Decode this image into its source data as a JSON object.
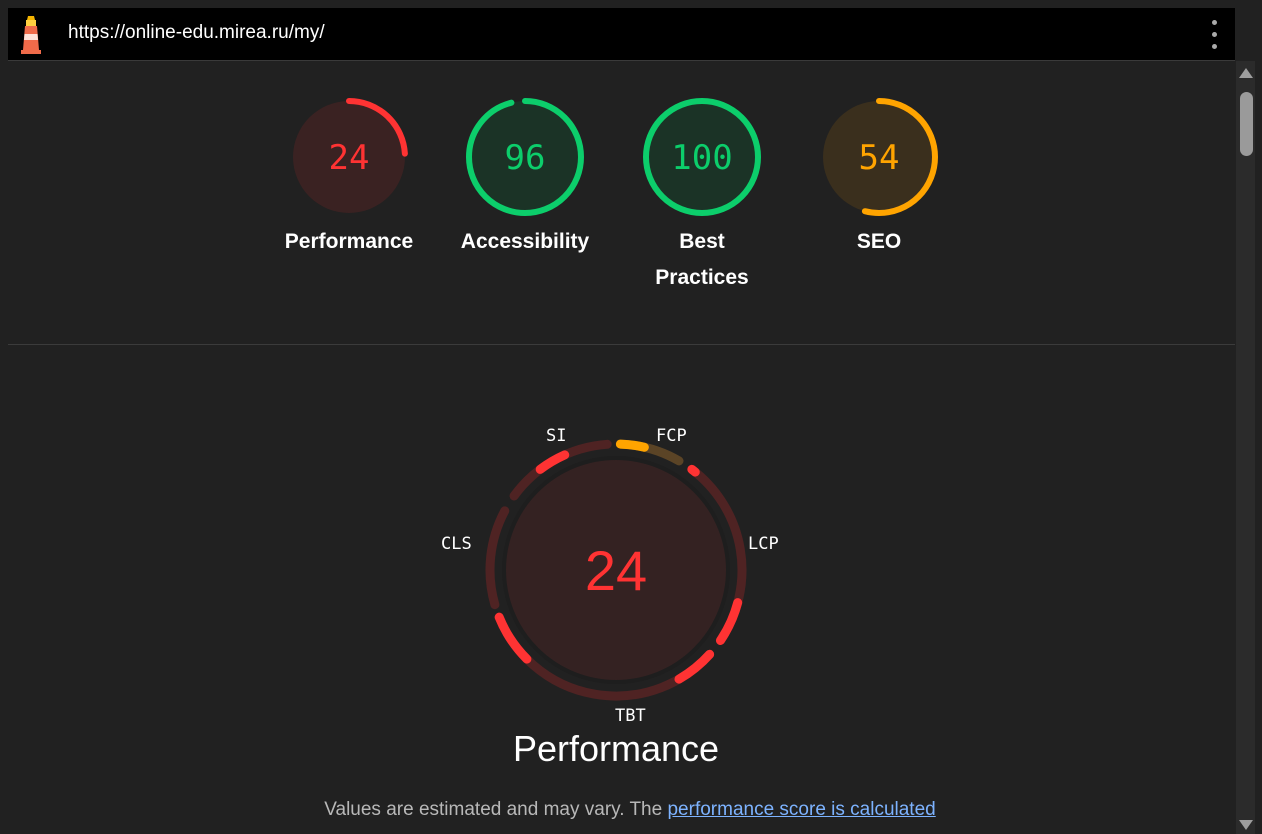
{
  "browser": {
    "url": "https://online-edu.mirea.ru/my/",
    "logo_icon": "lighthouse-icon",
    "menu_icon": "kebab-menu-icon"
  },
  "gauges": [
    {
      "label": "Performance",
      "score": "24",
      "fraction": 0.24,
      "color": "#ff3333",
      "bg": "#3a2222"
    },
    {
      "label": "Accessibility",
      "score": "96",
      "fraction": 0.96,
      "color": "#0cce6b",
      "bg": "#1b3326"
    },
    {
      "label": "Best Practices",
      "score": "100",
      "fraction": 1.0,
      "color": "#0cce6b",
      "bg": "#1b3326"
    },
    {
      "label": "SEO",
      "score": "54",
      "fraction": 0.54,
      "color": "#ffa400",
      "bg": "#3a2f1d"
    }
  ],
  "performance": {
    "score": "24",
    "title": "Performance",
    "metrics": [
      "FCP",
      "LCP",
      "TBT",
      "CLS",
      "SI"
    ]
  },
  "note": {
    "text": "Values are estimated and may vary. The ",
    "link": "performance score is calculated"
  },
  "colors": {
    "fail": "#ff3333",
    "average": "#ffa400",
    "pass": "#0cce6b"
  }
}
